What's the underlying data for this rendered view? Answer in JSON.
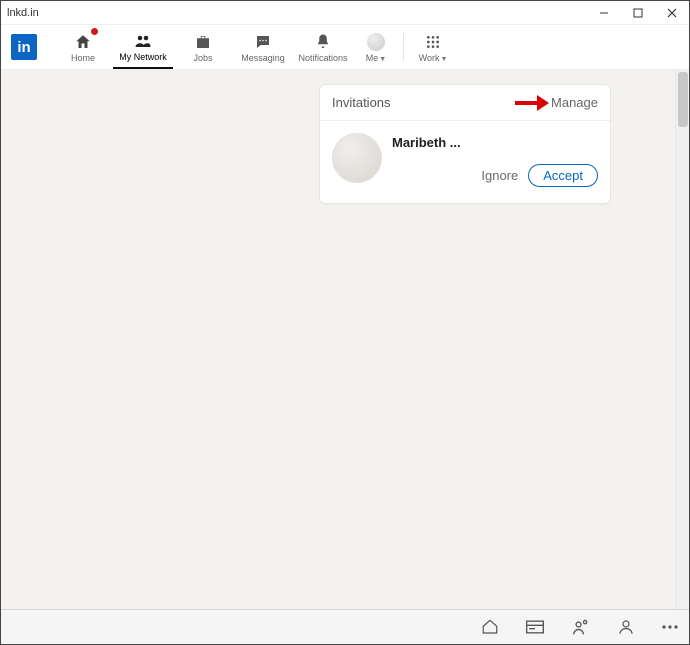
{
  "window": {
    "title": "lnkd.in",
    "logo_text": "in"
  },
  "nav": {
    "home": "Home",
    "network": "My Network",
    "jobs": "Jobs",
    "messaging": "Messaging",
    "notifications": "Notifications",
    "me": "Me",
    "work": "Work"
  },
  "invitations": {
    "title": "Invitations",
    "manage_label": "Manage",
    "items": [
      {
        "name": "Maribeth ...",
        "ignore": "Ignore",
        "accept": "Accept"
      }
    ]
  }
}
